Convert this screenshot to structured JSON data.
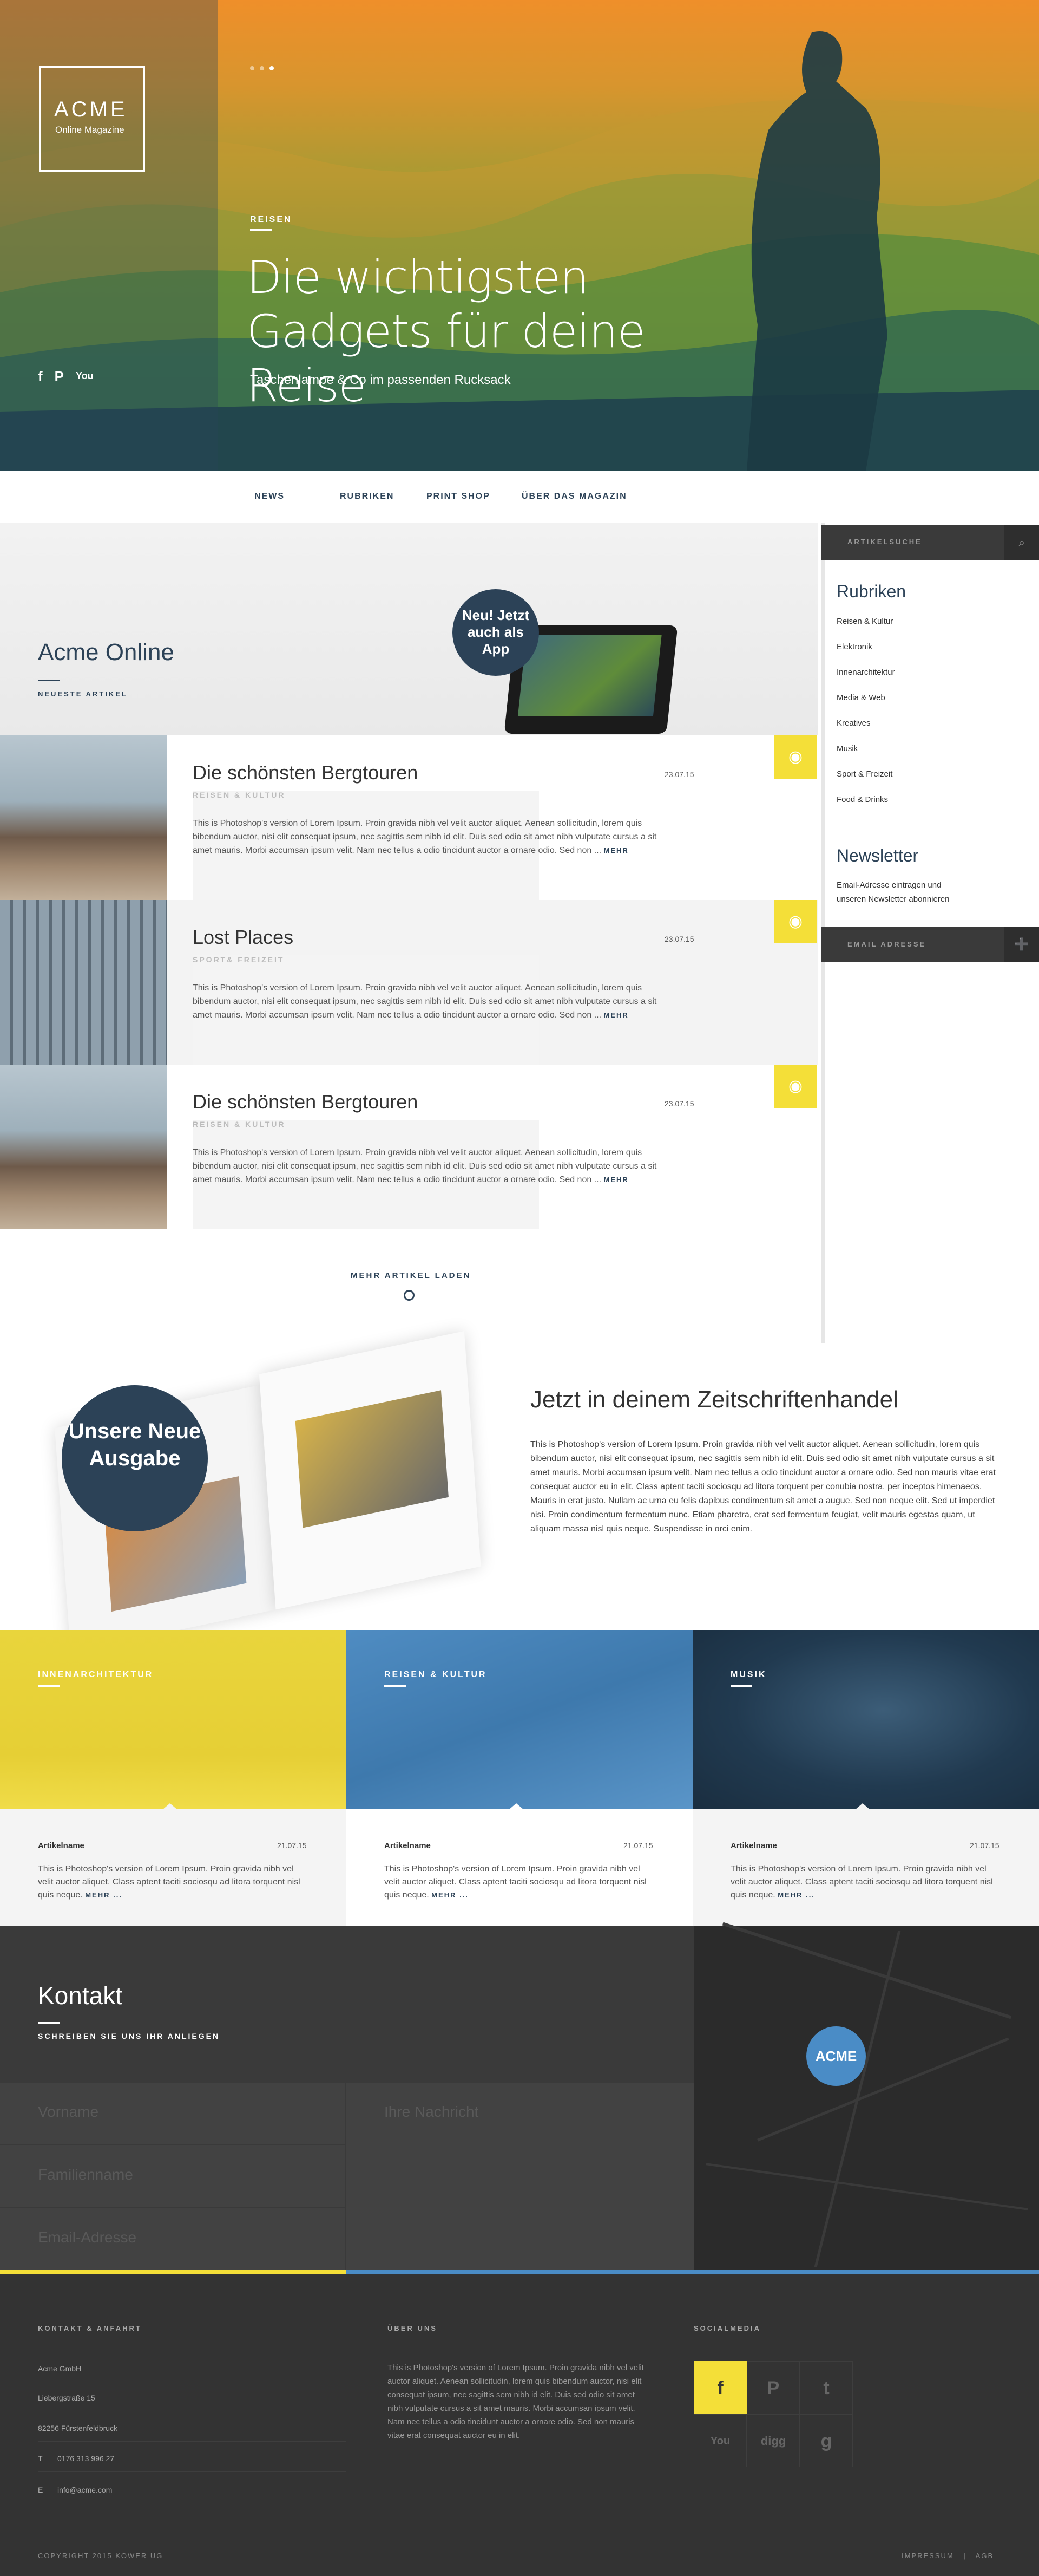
{
  "brand": {
    "name": "ACME",
    "tagline": "Online Magazine"
  },
  "hero": {
    "category": "REISEN",
    "title": "Die wichtigsten Gadgets für deine Reise",
    "subtitle": "Taschenlampe & Co im passenden Rucksack",
    "social": [
      "f",
      "P",
      "You"
    ]
  },
  "nav": [
    "NEWS",
    "RUBRIKEN",
    "PRINT SHOP",
    "ÜBER DAS MAGAZIN"
  ],
  "intro": {
    "title": "Acme Online",
    "sub": "NEUESTE ARTIKEL",
    "badge": "Neu! Jetzt auch als App"
  },
  "articles": [
    {
      "title": "Die schönsten Bergtouren",
      "cat": "REISEN & KULTUR",
      "date": "23.07.15",
      "text": "This is Photoshop's version of Lorem Ipsum. Proin gravida nibh vel velit auctor aliquet. Aenean sollicitudin, lorem quis bibendum auctor, nisi elit consequat ipsum, nec sagittis sem nibh id elit. Duis sed odio sit amet nibh vulputate cursus a sit amet mauris. Morbi accumsan ipsum velit. Nam nec tellus a odio tincidunt auctor a ornare odio. Sed non ...",
      "more": "MEHR"
    },
    {
      "title": "Lost Places",
      "cat": "SPORT& FREIZEIT",
      "date": "23.07.15",
      "text": "This is Photoshop's version of Lorem Ipsum. Proin gravida nibh vel velit auctor aliquet. Aenean sollicitudin, lorem quis bibendum auctor, nisi elit consequat ipsum, nec sagittis sem nibh id elit. Duis sed odio sit amet nibh vulputate cursus a sit amet mauris. Morbi accumsan ipsum velit. Nam nec tellus a odio tincidunt auctor a ornare odio. Sed non ...",
      "more": "MEHR"
    },
    {
      "title": "Die schönsten Bergtouren",
      "cat": "REISEN & KULTUR",
      "date": "23.07.15",
      "text": "This is Photoshop's version of Lorem Ipsum. Proin gravida nibh vel velit auctor aliquet. Aenean sollicitudin, lorem quis bibendum auctor, nisi elit consequat ipsum, nec sagittis sem nibh id elit. Duis sed odio sit amet nibh vulputate cursus a sit amet mauris. Morbi accumsan ipsum velit. Nam nec tellus a odio tincidunt auctor a ornare odio. Sed non ...",
      "more": "MEHR"
    }
  ],
  "more_label": "MEHR ARTIKEL LADEN",
  "sidebar": {
    "search_placeholder": "ARTIKELSUCHE",
    "rubriken_title": "Rubriken",
    "rubriken": [
      "Reisen & Kultur",
      "Elektronik",
      "Innenarchitektur",
      "Media & Web",
      "Kreatives",
      "Musik",
      "Sport & Freizeit",
      "Food & Drinks"
    ],
    "newsletter_title": "Newsletter",
    "newsletter_text": "Email-Adresse eintragen und unseren Newsletter abonnieren",
    "email_placeholder": "EMAIL ADRESSE"
  },
  "magazine": {
    "badge": "Unsere Neue Ausgabe",
    "title": "Jetzt in deinem Zeitschriftenhandel",
    "text": "This is Photoshop's version of Lorem Ipsum. Proin gravida nibh vel velit auctor aliquet. Aenean sollicitudin, lorem quis bibendum auctor, nisi elit consequat ipsum, nec sagittis sem nibh id elit. Duis sed odio sit amet nibh vulputate cursus a sit amet mauris. Morbi accumsan ipsum velit. Nam nec tellus a odio tincidunt auctor a ornare odio. Sed non mauris vitae erat consequat auctor eu in elit. Class aptent taciti sociosqu ad litora torquent per conubia nostra, per inceptos himenaeos. Mauris in erat justo. Nullam ac urna eu felis dapibus condimentum sit amet a augue. Sed non neque elit. Sed ut imperdiet nisi. Proin condimentum fermentum nunc. Etiam pharetra, erat sed fermentum feugiat, velit mauris egestas quam, ut aliquam massa nisl quis neque. Suspendisse in orci enim."
  },
  "categories": [
    {
      "label": "INNENARCHITEKTUR",
      "article": "Artikelname",
      "date": "21.07.15",
      "text": "This is Photoshop's version of Lorem Ipsum. Proin gravida nibh vel velit auctor aliquet. Class aptent taciti sociosqu ad litora torquent nisl quis neque.",
      "more": "MEHR ..."
    },
    {
      "label": "REISEN & KULTUR",
      "article": "Artikelname",
      "date": "21.07.15",
      "text": "This is Photoshop's version of Lorem Ipsum. Proin gravida nibh vel velit auctor aliquet. Class aptent taciti sociosqu ad litora torquent nisl quis neque.",
      "more": "MEHR ..."
    },
    {
      "label": "MUSIK",
      "article": "Artikelname",
      "date": "21.07.15",
      "text": "This is Photoshop's version of Lorem Ipsum. Proin gravida nibh vel velit auctor aliquet. Class aptent taciti sociosqu ad litora torquent nisl quis neque.",
      "more": "MEHR ..."
    }
  ],
  "kontakt": {
    "title": "Kontakt",
    "sub": "SCHREIBEN SIE UNS IHR ANLIEGEN",
    "fields": {
      "firstname": "Vorname",
      "lastname": "Familienname",
      "email": "Email-Adresse",
      "message": "Ihre Nachricht"
    },
    "map_pin": "ACME"
  },
  "footer": {
    "contact_h": "KONTAKT & ANFAHRT",
    "contact": [
      "Acme GmbH",
      "Liebergstraße 15",
      "82256 Fürstenfeldbruck"
    ],
    "phone_label": "T",
    "phone": "0176 313 996 27",
    "email_label": "E",
    "email": "info@acme.com",
    "about_h": "ÜBER UNS",
    "about": "This is Photoshop's version of Lorem Ipsum. Proin gravida nibh vel velit auctor aliquet. Aenean sollicitudin, lorem quis bibendum auctor, nisi elit consequat ipsum, nec sagittis sem nibh id elit. Duis sed odio sit amet nibh vulputate cursus a sit amet mauris. Morbi accumsan ipsum velit. Nam nec tellus a odio tincidunt auctor a ornare odio. Sed non mauris vitae erat consequat auctor eu in elit.",
    "social_h": "SOCIALMEDIA",
    "social": [
      "f",
      "P",
      "t",
      "You",
      "digg",
      "g"
    ],
    "copyright": "COPYRIGHT 2015 KOWER UG",
    "impressum": "IMPRESSUM",
    "agb": "AGB"
  }
}
